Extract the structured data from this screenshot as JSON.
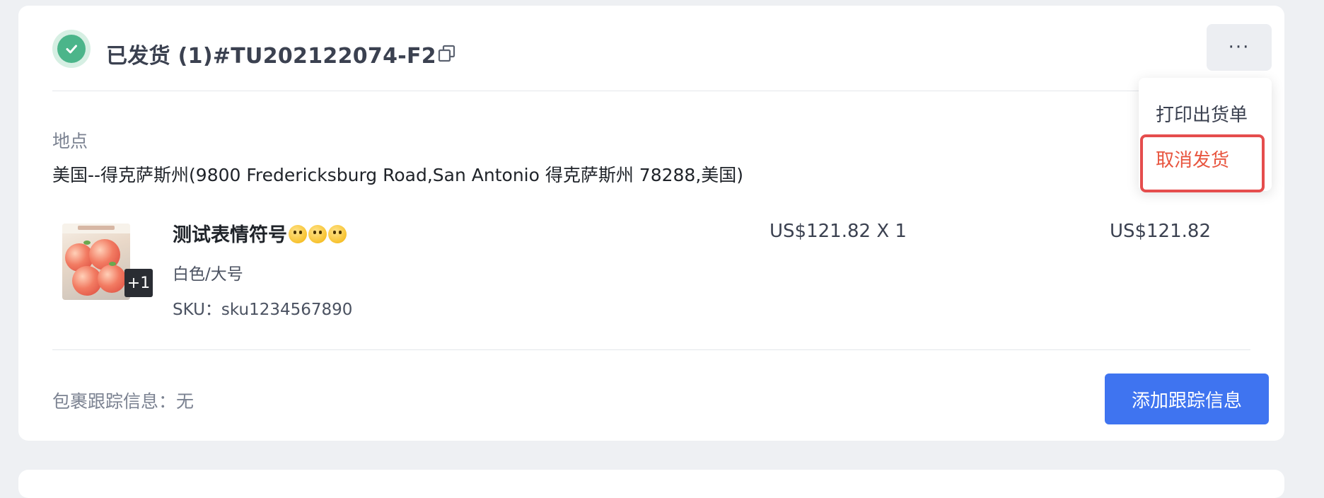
{
  "fulfillment": {
    "title": "已发货 (1)#TU202122074-F2",
    "status_icon": "check-icon",
    "status_color": "#4bb58a",
    "more_label": "···"
  },
  "menu": {
    "items": [
      "打印出货单",
      "取消发货"
    ],
    "danger_color": "#e8553f",
    "highlight_color": "#e54d4d"
  },
  "location": {
    "label": "地点",
    "address": "美国--得克萨斯州(9800 Fredericksburg Road,San Antonio 得克萨斯州 78288,美国)"
  },
  "product": {
    "name": "测试表情符号",
    "emoji_icons": [
      "grinning-face-icon",
      "grinning-sweat-icon",
      "tears-of-joy-icon"
    ],
    "variant": "白色/大号",
    "sku": "SKU：sku1234567890",
    "extra_images_badge": "+1",
    "unit_price": "US$121.82 X 1",
    "line_total": "US$121.82"
  },
  "tracking": {
    "label": "包裹跟踪信息：无",
    "button_label": "添加跟踪信息",
    "button_color": "#3f74f0"
  }
}
